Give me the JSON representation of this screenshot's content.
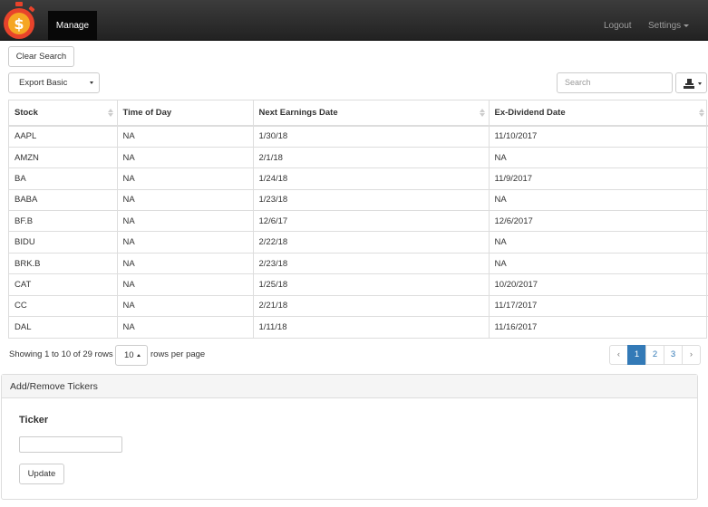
{
  "navbar": {
    "active_tab": "Manage",
    "logout": "Logout",
    "settings": "Settings",
    "logo_icon": "dollar-stopwatch-logo",
    "logo_symbol": "$"
  },
  "toolbar": {
    "clear_search": "Clear Search",
    "export_select": "Export Basic",
    "search_placeholder": "Search",
    "export_icon": "export-icon"
  },
  "table": {
    "columns": [
      "Stock",
      "Time of Day",
      "Next Earnings Date",
      "Ex-Dividend Date"
    ],
    "rows": [
      [
        "AAPL",
        "NA",
        "1/30/18",
        "11/10/2017"
      ],
      [
        "AMZN",
        "NA",
        "2/1/18",
        "NA"
      ],
      [
        "BA",
        "NA",
        "1/24/18",
        "11/9/2017"
      ],
      [
        "BABA",
        "NA",
        "1/23/18",
        "NA"
      ],
      [
        "BF.B",
        "NA",
        "12/6/17",
        "12/6/2017"
      ],
      [
        "BIDU",
        "NA",
        "2/22/18",
        "NA"
      ],
      [
        "BRK.B",
        "NA",
        "2/23/18",
        "NA"
      ],
      [
        "CAT",
        "NA",
        "1/25/18",
        "10/20/2017"
      ],
      [
        "CC",
        "NA",
        "2/21/18",
        "11/17/2017"
      ],
      [
        "DAL",
        "NA",
        "1/11/18",
        "11/16/2017"
      ]
    ]
  },
  "pagination": {
    "info": "Showing 1 to 10 of 29 rows",
    "page_size": "10",
    "per_page_label": "rows per page",
    "prev": "‹",
    "pages": [
      "1",
      "2",
      "3"
    ],
    "active_page": "1",
    "next": "›"
  },
  "panel": {
    "title": "Add/Remove Tickers",
    "ticker_label": "Ticker",
    "ticker_value": "",
    "update_button": "Update"
  },
  "colors": {
    "navbar_bg": "#222222",
    "active_page": "#337ab7",
    "logo_outer": "#e8432b",
    "logo_inner": "#f5a623"
  }
}
